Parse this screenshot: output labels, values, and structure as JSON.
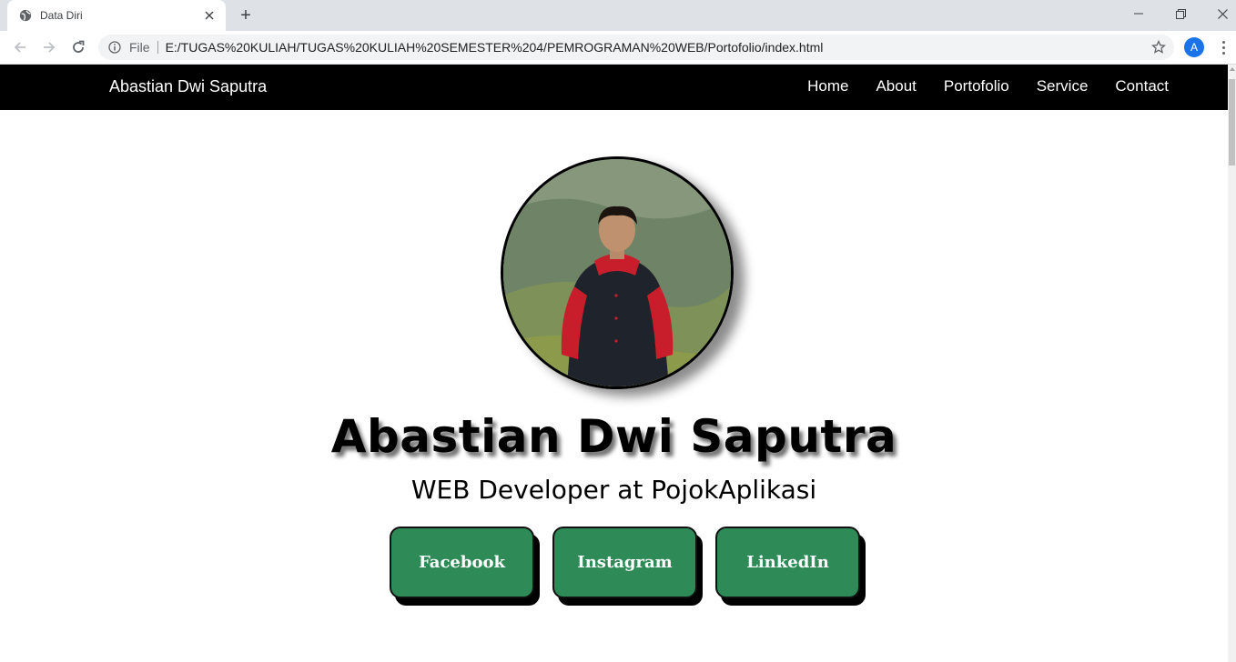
{
  "browser": {
    "tab_title": "Data Diri",
    "new_tab_symbol": "+",
    "address_prefix": "File",
    "url": "E:/TUGAS%20KULIAH/TUGAS%20KULIAH%20SEMESTER%204/PEMROGRAMAN%20WEB/Portofolio/index.html",
    "profile_initial": "A"
  },
  "site": {
    "brand": "Abastian Dwi Saputra",
    "menu": [
      {
        "label": "Home"
      },
      {
        "label": "About"
      },
      {
        "label": "Portofolio"
      },
      {
        "label": "Service"
      },
      {
        "label": "Contact"
      }
    ]
  },
  "hero": {
    "name": "Abastian Dwi Saputra",
    "role": "WEB Developer at PojokAplikasi",
    "buttons": [
      {
        "label": "Facebook"
      },
      {
        "label": "Instagram"
      },
      {
        "label": "LinkedIn"
      }
    ]
  },
  "colors": {
    "navbar_bg": "#000000",
    "button_green": "#2e8b57",
    "profile_avatar_accent": "#1a73e8"
  }
}
